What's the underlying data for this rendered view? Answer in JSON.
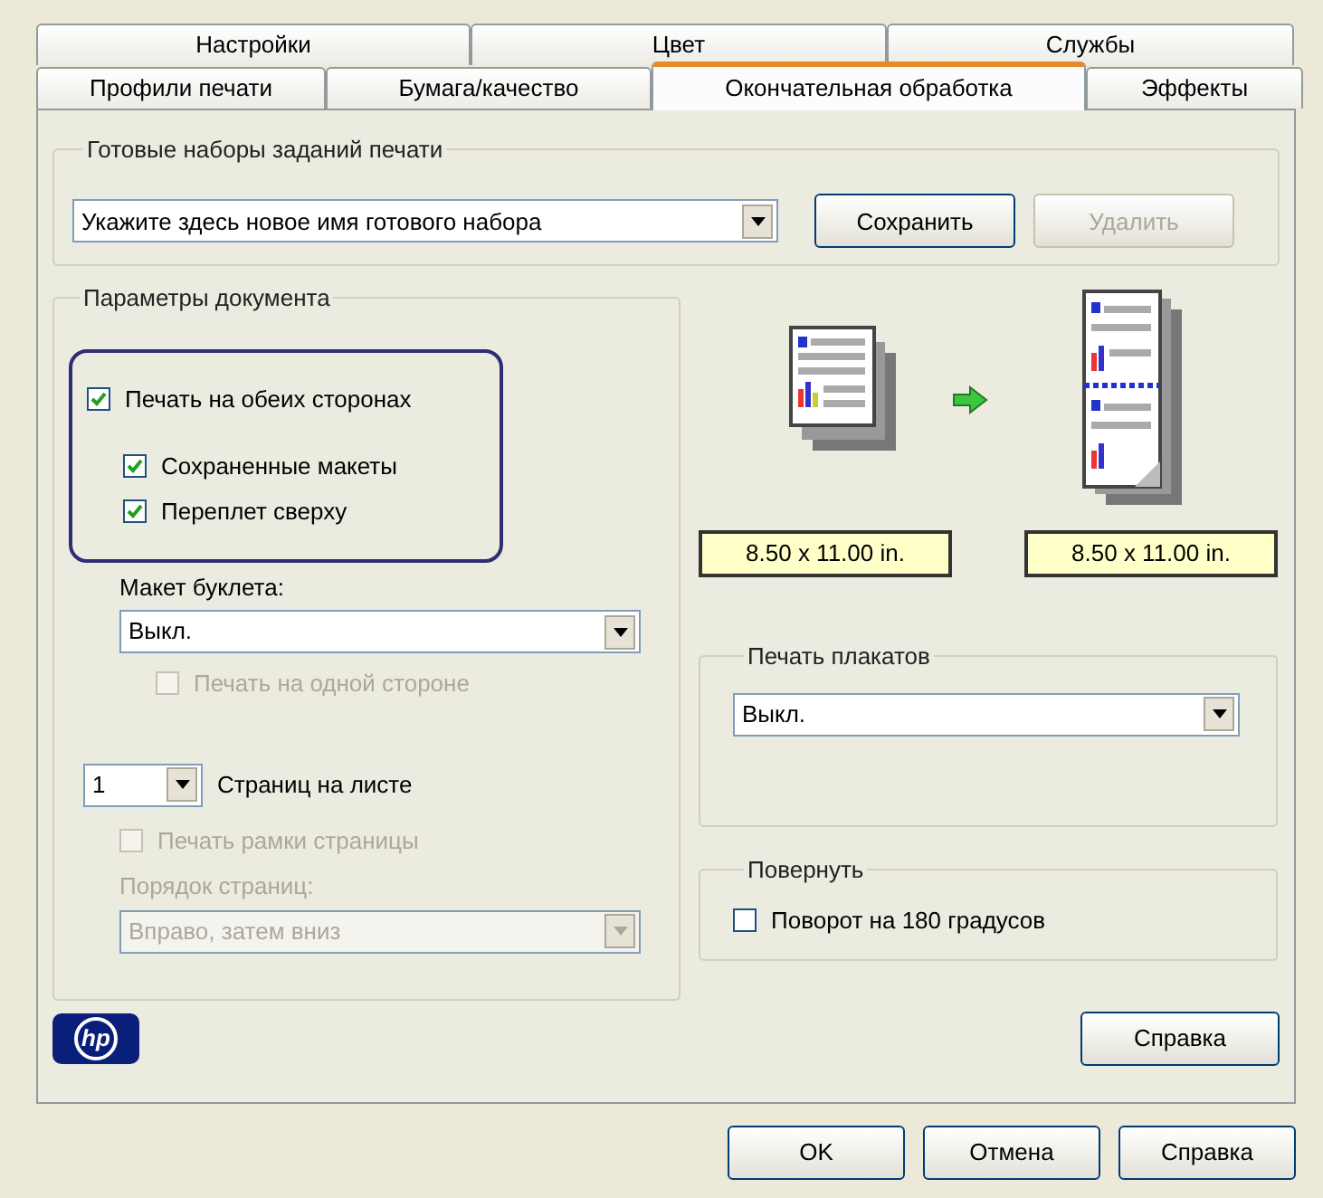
{
  "tabs": {
    "rows": [
      [
        {
          "label": "Настройки",
          "selected": false
        },
        {
          "label": "Цвет",
          "selected": false
        },
        {
          "label": "Службы",
          "selected": false
        }
      ],
      [
        {
          "label": "Профили печати",
          "selected": false
        },
        {
          "label": "Бумага/качество",
          "selected": false
        },
        {
          "label": "Окончательная обработка",
          "selected": true
        },
        {
          "label": "Эффекты",
          "selected": false
        }
      ]
    ]
  },
  "presets": {
    "title": "Готовые наборы заданий печати",
    "value": "Укажите здесь новое имя готового набора",
    "buttons": [
      {
        "label": "Сохранить",
        "disabled": false
      },
      {
        "label": "Удалить",
        "disabled": true
      }
    ]
  },
  "document": {
    "title": "Параметры документа",
    "duplex": {
      "label": "Печать на обеих сторонах",
      "checked": true
    },
    "duplex_options": [
      {
        "label": "Сохраненные макеты",
        "checked": true
      },
      {
        "label": "Переплет сверху",
        "checked": true
      }
    ],
    "booklet": {
      "label": "Макет буклета:",
      "value": "Выкл."
    },
    "one_side": {
      "label": "Печать на одной стороне",
      "checked": false,
      "disabled": true
    },
    "pages_per_sheet": {
      "value": "1",
      "label": "Страниц на листе"
    },
    "page_borders": {
      "label": "Печать рамки страницы",
      "checked": false,
      "disabled": true
    },
    "page_order": {
      "label": "Порядок страниц:",
      "value": "Вправо, затем вниз",
      "disabled": true
    }
  },
  "preview": {
    "sizes": [
      "8.50 x 11.00 in.",
      "8.50 x 11.00 in."
    ]
  },
  "poster": {
    "title": "Печать плакатов",
    "value": "Выкл."
  },
  "rotate": {
    "title": "Повернуть",
    "checkbox": {
      "label": "Поворот на 180 градусов",
      "checked": false
    }
  },
  "logo": "hp",
  "help_button": "Справка",
  "footer_buttons": [
    "OK",
    "Отмена",
    "Справка"
  ]
}
